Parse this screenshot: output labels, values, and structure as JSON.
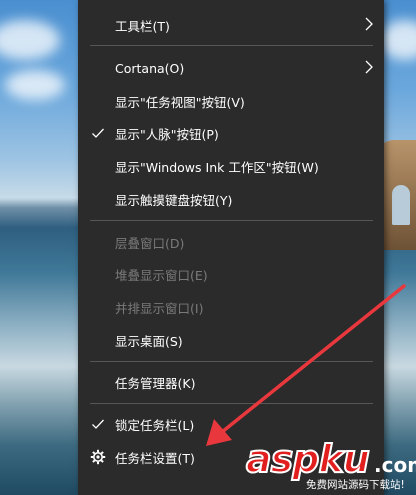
{
  "menu": {
    "items": [
      {
        "label": "工具栏(T)",
        "submenu": true,
        "checked": false,
        "disabled": false
      },
      {
        "label": "Cortana(O)",
        "submenu": true,
        "checked": false,
        "disabled": false
      },
      {
        "label": "显示\"任务视图\"按钮(V)",
        "submenu": false,
        "checked": false,
        "disabled": false
      },
      {
        "label": "显示\"人脉\"按钮(P)",
        "submenu": false,
        "checked": true,
        "disabled": false
      },
      {
        "label": "显示\"Windows Ink 工作区\"按钮(W)",
        "submenu": false,
        "checked": false,
        "disabled": false
      },
      {
        "label": "显示触摸键盘按钮(Y)",
        "submenu": false,
        "checked": false,
        "disabled": false
      },
      {
        "label": "层叠窗口(D)",
        "submenu": false,
        "checked": false,
        "disabled": true
      },
      {
        "label": "堆叠显示窗口(E)",
        "submenu": false,
        "checked": false,
        "disabled": true
      },
      {
        "label": "并排显示窗口(I)",
        "submenu": false,
        "checked": false,
        "disabled": true
      },
      {
        "label": "显示桌面(S)",
        "submenu": false,
        "checked": false,
        "disabled": false
      },
      {
        "label": "任务管理器(K)",
        "submenu": false,
        "checked": false,
        "disabled": false
      },
      {
        "label": "锁定任务栏(L)",
        "submenu": false,
        "checked": true,
        "disabled": false
      },
      {
        "label": "任务栏设置(T)",
        "submenu": false,
        "checked": false,
        "disabled": false,
        "icon": "gear-icon"
      }
    ]
  },
  "watermark": {
    "main": "aspku",
    "tld": ".com",
    "sub": "免费网站源码下载站!"
  },
  "colors": {
    "menu_bg": "#2b2b2b",
    "menu_text": "#ffffff",
    "disabled_text": "#7a7a7a",
    "separator": "#565656",
    "annotation_arrow": "#e8383d"
  }
}
